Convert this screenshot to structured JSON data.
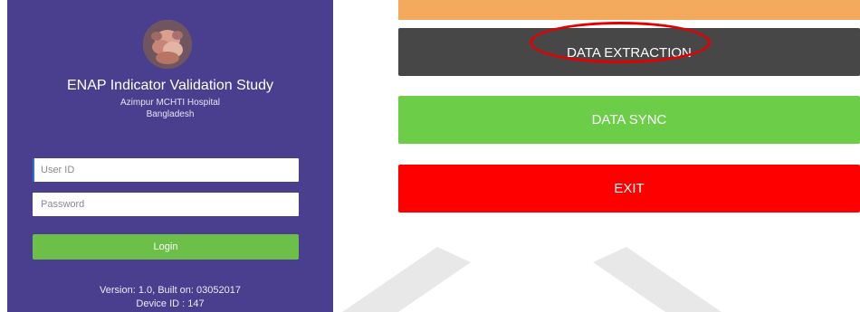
{
  "login": {
    "title": "ENAP Indicator Validation Study",
    "hospital": "Azimpur MCHTI Hospital",
    "country": "Bangladesh",
    "userid_placeholder": "User ID",
    "password_placeholder": "Password",
    "login_label": "Login",
    "version": "Version: 1.0, Built on: 03052017",
    "device": "Device ID : 147"
  },
  "menu": {
    "data_extraction_label": "DATA EXTRACTION",
    "data_sync_label": "DATA SYNC",
    "exit_label": "EXIT"
  },
  "colors": {
    "login_background": "#4a3f8e",
    "login_button": "#6cc04a",
    "strip_orange": "#f3aa5c",
    "extraction_button": "#474747",
    "sync_button": "#6cce48",
    "exit_button": "#ff0000",
    "highlight_ring": "#e30000"
  },
  "icons": {
    "logo": "newborn-baby-photo"
  }
}
